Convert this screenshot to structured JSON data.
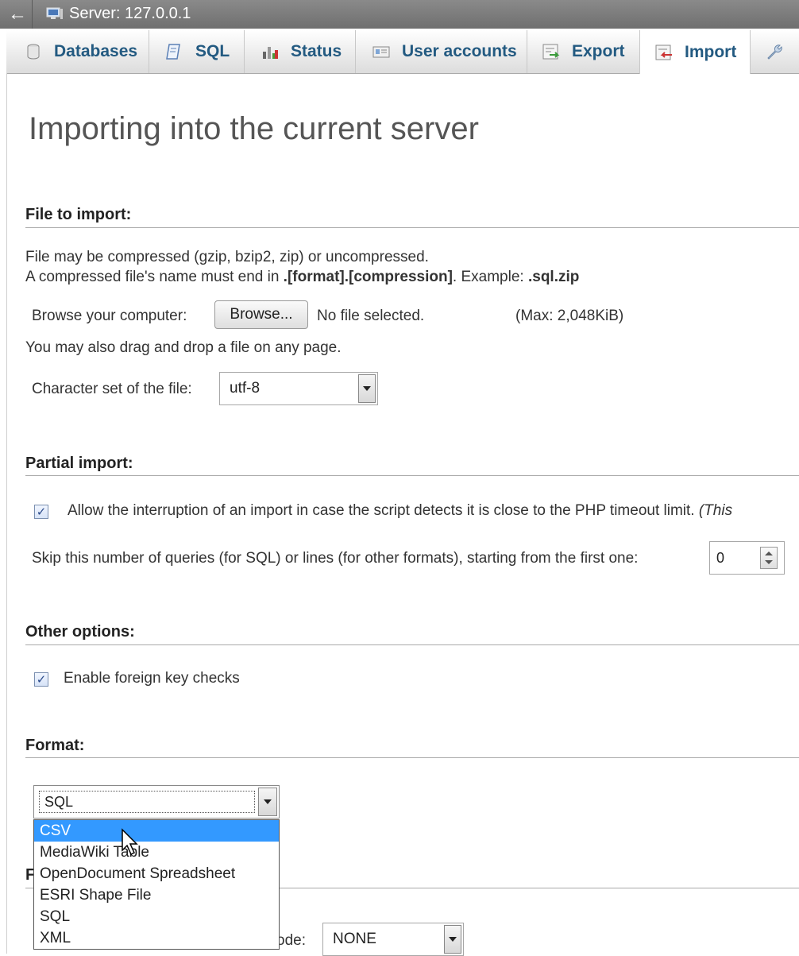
{
  "topbar": {
    "back": "←",
    "server_label": "Server: 127.0.0.1"
  },
  "tabs": [
    {
      "label": "Databases",
      "icon": "database-icon"
    },
    {
      "label": "SQL",
      "icon": "sql-icon"
    },
    {
      "label": "Status",
      "icon": "status-icon"
    },
    {
      "label": "User accounts",
      "icon": "users-icon"
    },
    {
      "label": "Export",
      "icon": "export-icon"
    },
    {
      "label": "Import",
      "icon": "import-icon"
    },
    {
      "label": "",
      "icon": "wrench-icon"
    }
  ],
  "page_title": "Importing into the current server",
  "file_section": {
    "title": "File to import:",
    "line1": "File may be compressed (gzip, bzip2, zip) or uncompressed.",
    "line2_pre": "A compressed file's name must end in ",
    "line2_bold": ".[format].[compression]",
    "line2_mid": ". Example: ",
    "line2_example": ".sql.zip",
    "browse_label": "Browse your computer:",
    "browse_button": "Browse...",
    "no_file": "No file selected.",
    "max_size": "(Max: 2,048KiB)",
    "drag_note": "You may also drag and drop a file on any page.",
    "charset_label": "Character set of the file:",
    "charset_value": "utf-8"
  },
  "partial_section": {
    "title": "Partial import:",
    "allow_interrupt": "Allow the interruption of an import in case the script detects it is close to the PHP timeout limit.",
    "allow_interrupt_note": "(This",
    "skip_label": "Skip this number of queries (for SQL) or lines (for other formats), starting from the first one:",
    "skip_value": "0"
  },
  "other_section": {
    "title": "Other options:",
    "foreign_keys": "Enable foreign key checks"
  },
  "format_section": {
    "title": "Format:",
    "selected": "SQL",
    "options": [
      "CSV",
      "MediaWiki Table",
      "OpenDocument Spreadsheet",
      "ESRI Shape File",
      "SQL",
      "XML"
    ],
    "highlighted": "CSV",
    "partial_label_F": "F",
    "partial_label_ode": "ode:",
    "mode_value": "NONE"
  },
  "colors": {
    "tab_text": "#235a81",
    "highlight": "#3399ff",
    "topbar": "#7a7a7a"
  }
}
